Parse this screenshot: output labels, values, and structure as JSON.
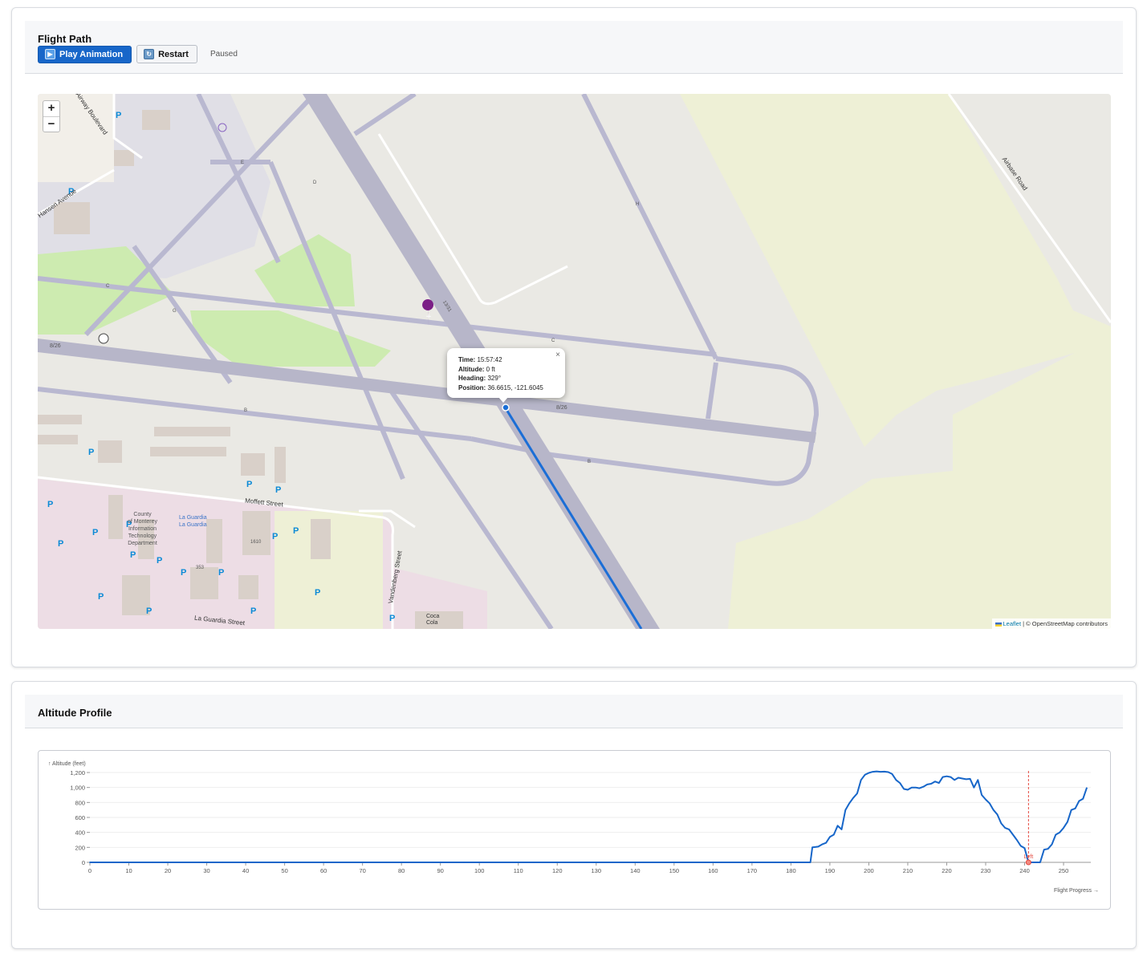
{
  "flight_panel": {
    "title": "Flight Path",
    "play_label": "Play Animation",
    "restart_label": "Restart",
    "status": "Paused"
  },
  "map": {
    "zoom_in": "+",
    "zoom_out": "−",
    "popup": {
      "time_label": "Time:",
      "time_value": "15:57:42",
      "altitude_label": "Altitude:",
      "altitude_value": "0 ft",
      "heading_label": "Heading:",
      "heading_value": "329°",
      "position_label": "Position:",
      "position_value": "36.6615, -121.6045",
      "close": "×"
    },
    "attribution_link": "Leaflet",
    "attribution_text": " | © OpenStreetMap contributors",
    "labels": {
      "moffett": "Moffett Street",
      "laguardia": "La Guardia Street",
      "vandenberg": "Vandenberg Street",
      "airbase": "Airbase Road",
      "boulevard": "Airway Boulevard",
      "avenue": "Hansen Avenue",
      "county1": "County",
      "county2": "of Monterey",
      "county3": "Information",
      "county4": "Technology",
      "county5": "Department",
      "laguardia_poi1": "La Guardia",
      "laguardia_poi2": "La Guardia",
      "coca1": "Coca",
      "coca2": "Cola",
      "runway": "8/26",
      "runway2": "8/26",
      "runway_cross": "13/31",
      "bldg1610": "1610",
      "bldg353": "353",
      "tw_b": "B",
      "tw_b2": "B",
      "tw_c": "C",
      "tw_c2": "C",
      "tw_d": "D",
      "tw_e": "E",
      "tw_g": "G",
      "tw_h": "H"
    }
  },
  "altitude_panel": {
    "title": "Altitude Profile"
  },
  "chart_data": {
    "type": "line",
    "ylabel": "↑ Altitude (feet)",
    "xlabel": "Flight Progress →",
    "xlim": [
      0,
      257
    ],
    "ylim": [
      0,
      1200
    ],
    "x_ticks": [
      0,
      10,
      20,
      30,
      40,
      50,
      60,
      70,
      80,
      90,
      100,
      110,
      120,
      130,
      140,
      150,
      160,
      170,
      180,
      190,
      200,
      210,
      220,
      230,
      240,
      250
    ],
    "y_ticks": [
      0,
      200,
      400,
      600,
      800,
      1000,
      1200
    ],
    "y_tick_labels": [
      "0",
      "200",
      "400",
      "600",
      "800",
      "1,000",
      "1,200"
    ],
    "marker": {
      "x": 241,
      "label": "Left"
    },
    "series": [
      {
        "points": [
          [
            0,
            0
          ],
          [
            184,
            0
          ],
          [
            185,
            0
          ],
          [
            185.5,
            200
          ],
          [
            187,
            210
          ],
          [
            188,
            240
          ],
          [
            189,
            260
          ],
          [
            190,
            340
          ],
          [
            191,
            370
          ],
          [
            192,
            490
          ],
          [
            193,
            440
          ],
          [
            194,
            700
          ],
          [
            195,
            790
          ],
          [
            196,
            860
          ],
          [
            197,
            920
          ],
          [
            198,
            1100
          ],
          [
            199,
            1170
          ],
          [
            200,
            1195
          ],
          [
            201,
            1210
          ],
          [
            202,
            1215
          ],
          [
            203,
            1210
          ],
          [
            204,
            1212
          ],
          [
            205,
            1205
          ],
          [
            206,
            1180
          ],
          [
            207,
            1100
          ],
          [
            208,
            1060
          ],
          [
            209,
            980
          ],
          [
            210,
            970
          ],
          [
            211,
            1000
          ],
          [
            212,
            1000
          ],
          [
            213,
            990
          ],
          [
            214,
            1010
          ],
          [
            215,
            1040
          ],
          [
            216,
            1050
          ],
          [
            217,
            1080
          ],
          [
            218,
            1060
          ],
          [
            219,
            1140
          ],
          [
            220,
            1150
          ],
          [
            221,
            1140
          ],
          [
            222,
            1100
          ],
          [
            223,
            1130
          ],
          [
            224,
            1120
          ],
          [
            225,
            1110
          ],
          [
            226,
            1115
          ],
          [
            227,
            1000
          ],
          [
            228,
            1100
          ],
          [
            229,
            900
          ],
          [
            230,
            840
          ],
          [
            231,
            790
          ],
          [
            232,
            700
          ],
          [
            233,
            640
          ],
          [
            234,
            520
          ],
          [
            235,
            460
          ],
          [
            236,
            440
          ],
          [
            237,
            370
          ],
          [
            238,
            300
          ],
          [
            239,
            220
          ],
          [
            240,
            190
          ],
          [
            241,
            0
          ],
          [
            242,
            0
          ],
          [
            243,
            0
          ],
          [
            244,
            0
          ],
          [
            245,
            170
          ],
          [
            246,
            180
          ],
          [
            247,
            240
          ],
          [
            248,
            370
          ],
          [
            249,
            400
          ],
          [
            250,
            460
          ],
          [
            251,
            540
          ],
          [
            252,
            700
          ],
          [
            253,
            720
          ],
          [
            254,
            820
          ],
          [
            255,
            850
          ],
          [
            256,
            1000
          ]
        ]
      }
    ]
  }
}
